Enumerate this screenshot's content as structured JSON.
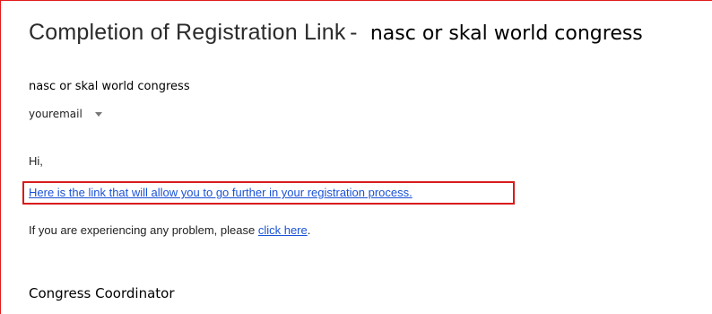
{
  "email": {
    "subject": "Completion of Registration Link",
    "subject_separator": "-",
    "subject_sender": "nasc or skal world congress",
    "sender_name": "nasc or skal world congress",
    "recipient": "youremail",
    "greeting": "Hi,",
    "main_link_text": "Here is the link that will allow you to go further in your registration process.",
    "problem_text_before": "If you are experiencing any problem, please ",
    "problem_link_text": "click here",
    "problem_text_after": ".",
    "signature": "Congress Coordinator"
  },
  "colors": {
    "highlight_border": "#d81b1b",
    "link": "#1a52d6"
  },
  "icons": {
    "recipient_dropdown": "caret-down-icon"
  }
}
